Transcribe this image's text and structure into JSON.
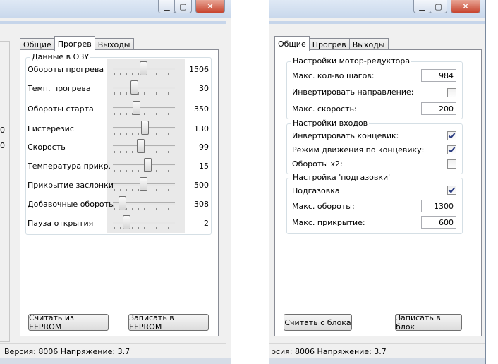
{
  "left_window": {
    "tabs": [
      {
        "label": "Общие"
      },
      {
        "label": "Прогрев"
      },
      {
        "label": "Выходы"
      }
    ],
    "group_title": "Данные в ОЗУ",
    "rows": [
      {
        "label": "Обороты прогрева",
        "value": "1506",
        "position": 0.5
      },
      {
        "label": "Темп. прогрева",
        "value": "30",
        "position": 0.35
      },
      {
        "label": "Обороты старта",
        "value": "350",
        "position": 0.38
      },
      {
        "label": "Гистерезис",
        "value": "130",
        "position": 0.52
      },
      {
        "label": "Скорость",
        "value": "99",
        "position": 0.45
      },
      {
        "label": "Температура прикр.",
        "value": "15",
        "position": 0.57
      },
      {
        "label": "Прикрытие заслонки",
        "value": "500",
        "position": 0.5
      },
      {
        "label": "Добавочные обороты",
        "value": "308",
        "position": 0.14
      },
      {
        "label": "Пауза открытия",
        "value": "2",
        "position": 0.22
      }
    ],
    "read_button": "Считать из EEPROM",
    "write_button": "Записать в EEPROM",
    "side_values": [
      "0",
      "0"
    ],
    "status": "Версия: 8006 Напряжение: 3.7"
  },
  "right_window": {
    "tabs": [
      {
        "label": "Общие"
      },
      {
        "label": "Прогрев"
      },
      {
        "label": "Выходы"
      }
    ],
    "motor_group": {
      "title": "Настройки мотор-редуктора",
      "max_steps_label": "Макс. кол-во шагов:",
      "max_steps_value": "984",
      "invert_dir_label": "Инвертировать направление:",
      "invert_dir_checked": false,
      "max_speed_label": "Макс. скорость:",
      "max_speed_value": "200"
    },
    "inputs_group": {
      "title": "Настройки  входов",
      "invert_endstop_label": "Инвертировать концевик:",
      "invert_endstop_checked": true,
      "endstop_mode_label": "Режим движения по концевику:",
      "endstop_mode_checked": true,
      "rpm_x2_label": "Обороты x2:",
      "rpm_x2_checked": false
    },
    "choke_group": {
      "title": "Настройка 'подгазовки'",
      "choke_label": "Подгазовка",
      "choke_checked": true,
      "max_rpm_label": "Макс. обороты:",
      "max_rpm_value": "1300",
      "max_close_label": "Макс. прикрытие:",
      "max_close_value": "600"
    },
    "read_button": "Считать с блока",
    "write_button": "Записать в блок",
    "status": "рсия: 8006 Напряжение: 3.7"
  },
  "title_buttons": {
    "minimize": "▁",
    "maximize": "▢",
    "close": "✕"
  }
}
